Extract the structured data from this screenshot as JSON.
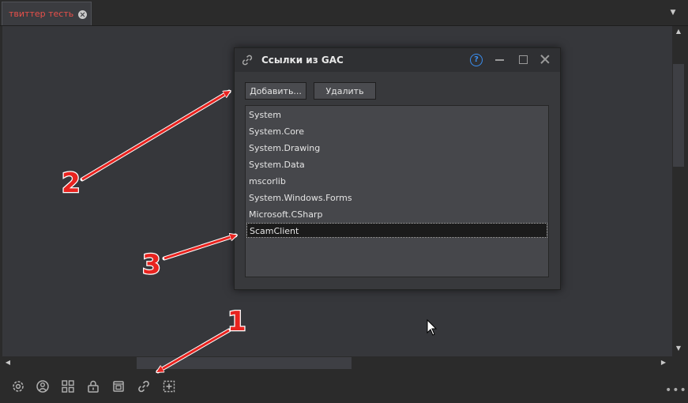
{
  "tab": {
    "label": "твиттер тесть"
  },
  "dialog": {
    "title": "Ссылки из GAC",
    "help_label": "?",
    "add_label": "Добавить...",
    "delete_label": "Удалить",
    "items": [
      "System",
      "System.Core",
      "System.Drawing",
      "System.Data",
      "mscorlib",
      "System.Windows.Forms",
      "Microsoft.CSharp",
      "ScamClient"
    ],
    "selected_index": 7
  },
  "annotations": {
    "marker_1": "1",
    "marker_2": "2",
    "marker_3": "3"
  },
  "colors": {
    "accent": "#3a8ef0",
    "tab_text": "#e8504a",
    "arrow": "#e8231f"
  },
  "bottom_icons": [
    "settings-icon",
    "user-circle-icon",
    "grid-icon",
    "lock-icon",
    "package-icon",
    "link-icon",
    "add-box-icon"
  ]
}
